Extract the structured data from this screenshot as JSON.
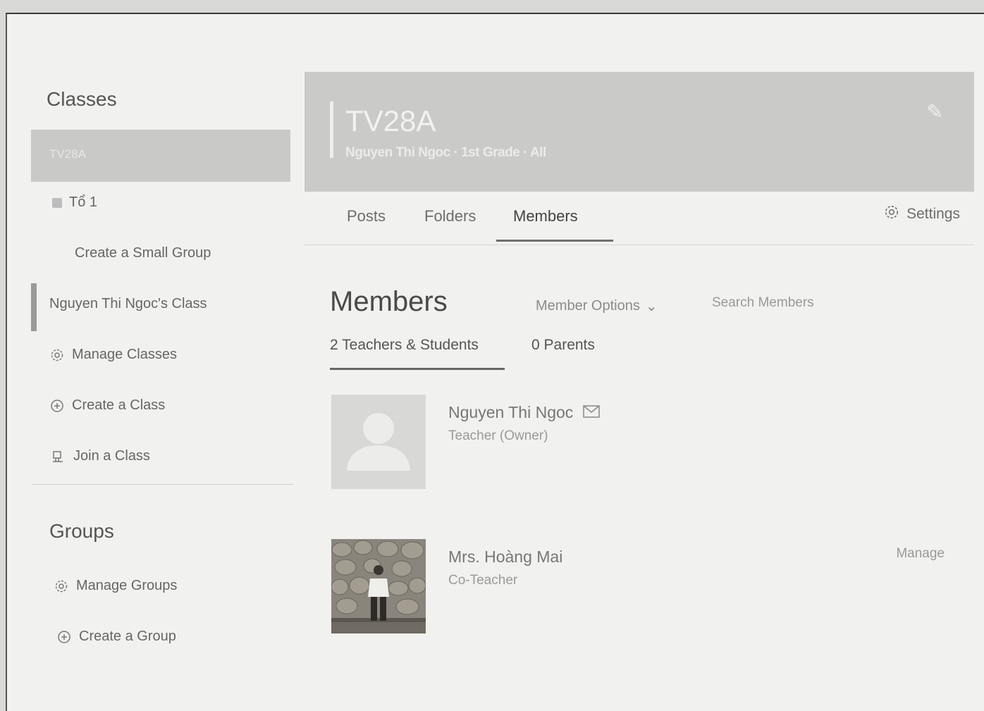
{
  "sidebar": {
    "classes_title": "Classes",
    "active_class": "TV28A",
    "items": [
      {
        "label": "Tổ 1"
      },
      {
        "label": "Create a Small Group"
      },
      {
        "label": "Nguyen Thi Ngoc's Class"
      },
      {
        "label": "Manage Classes"
      },
      {
        "label": "Create a Class"
      },
      {
        "label": "Join a Class"
      }
    ],
    "groups_title": "Groups",
    "group_items": [
      {
        "label": "Manage Groups"
      },
      {
        "label": "Create a Group"
      }
    ]
  },
  "banner": {
    "title": "TV28A",
    "subtitle": "Nguyen Thi Ngoc · 1st Grade · All"
  },
  "tabs": [
    "Posts",
    "Folders",
    "Members"
  ],
  "settings_label": "Settings",
  "members": {
    "title": "Members",
    "options_label": "Member Options",
    "search_placeholder": "Search Members",
    "sub_tabs": [
      "2 Teachers & Students",
      "0 Parents"
    ],
    "list": [
      {
        "name": "Nguyen Thi Ngoc",
        "role": "Teacher (Owner)"
      },
      {
        "name": "Mrs. Hoàng Mai",
        "role": "Co-Teacher",
        "action": "Manage"
      }
    ]
  },
  "colors": {
    "banner": "#cacac8",
    "active_class_bg": "#c9c9c7",
    "page_bg": "#f1f1ef"
  }
}
